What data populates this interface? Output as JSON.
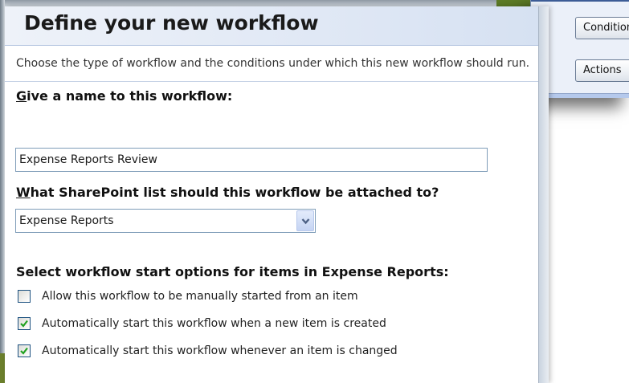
{
  "back_dialog": {
    "buttons": [
      {
        "label": "Conditions"
      },
      {
        "label": "Actions"
      }
    ]
  },
  "dialog": {
    "title": "Define your new workflow",
    "description": "Choose the type of workflow and the conditions under which this new workflow should run.",
    "name_field": {
      "label_accel": "G",
      "label_rest": "ive a name to this workflow:",
      "value": "Expense Reports Review"
    },
    "list_field": {
      "label_accel": "W",
      "label_rest": "hat SharePoint list should this workflow be attached to?",
      "selected": "Expense Reports"
    },
    "start_options": {
      "heading": "Select workflow start options for items in Expense Reports:",
      "options": [
        {
          "label": "Allow this workflow to be manually started from an item",
          "checked": false
        },
        {
          "label": "Automatically start this workflow when a new item is created",
          "checked": true
        },
        {
          "label": "Automatically start this workflow whenever an item is changed",
          "checked": true
        }
      ]
    }
  },
  "colors": {
    "check": "#21a121",
    "checkbox_border": "#1c5180",
    "header_gradient_end": "#d6e1f2"
  }
}
